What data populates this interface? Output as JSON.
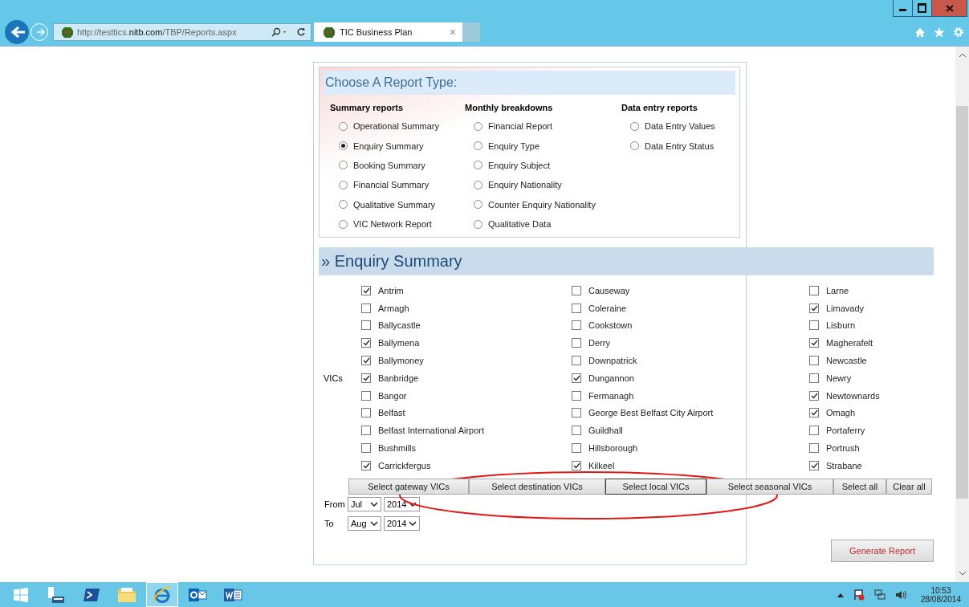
{
  "browser": {
    "address": "http://testtics.**nitb.com**/TBP/Reports.aspx",
    "tab_title": "TIC Business Plan",
    "tab_close": "×"
  },
  "report_type": {
    "title": "Choose A Report Type:",
    "groups": [
      {
        "heading": "Summary reports",
        "options": [
          {
            "label": "Operational Summary",
            "selected": false
          },
          {
            "label": "Enquiry Summary",
            "selected": true
          },
          {
            "label": "Booking Summary",
            "selected": false
          },
          {
            "label": "Financial Summary",
            "selected": false
          },
          {
            "label": "Qualitative Summary",
            "selected": false
          },
          {
            "label": "VIC Network Report",
            "selected": false
          }
        ]
      },
      {
        "heading": "Monthly breakdowns",
        "options": [
          {
            "label": "Financial Report",
            "selected": false
          },
          {
            "label": "Enquiry Type",
            "selected": false
          },
          {
            "label": "Enquiry Subject",
            "selected": false
          },
          {
            "label": "Enquiry Nationality",
            "selected": false
          },
          {
            "label": "Counter Enquiry Nationality",
            "selected": false
          },
          {
            "label": "Qualitative Data",
            "selected": false
          }
        ]
      },
      {
        "heading": "Data entry reports",
        "options": [
          {
            "label": "Data Entry Values",
            "selected": false
          },
          {
            "label": "Data Entry Status",
            "selected": false
          }
        ]
      }
    ]
  },
  "enquiry_summary": {
    "title": "» Enquiry Summary",
    "vics_label": "VICs",
    "columns": [
      {
        "items": [
          {
            "label": "Antrim",
            "checked": true
          },
          {
            "label": "Armagh",
            "checked": false
          },
          {
            "label": "Ballycastle",
            "checked": false
          },
          {
            "label": "Ballymena",
            "checked": true
          },
          {
            "label": "Ballymoney",
            "checked": true
          },
          {
            "label": "Banbridge",
            "checked": true
          },
          {
            "label": "Bangor",
            "checked": false
          },
          {
            "label": "Belfast",
            "checked": false
          },
          {
            "label": "Belfast International Airport",
            "checked": false
          },
          {
            "label": "Bushmills",
            "checked": false
          },
          {
            "label": "Carrickfergus",
            "checked": true
          }
        ]
      },
      {
        "items": [
          {
            "label": "Causeway",
            "checked": false
          },
          {
            "label": "Coleraine",
            "checked": false
          },
          {
            "label": "Cookstown",
            "checked": false
          },
          {
            "label": "Derry",
            "checked": false
          },
          {
            "label": "Downpatrick",
            "checked": false
          },
          {
            "label": "Dungannon",
            "checked": true
          },
          {
            "label": "Fermanagh",
            "checked": false
          },
          {
            "label": "George Best Belfast City Airport",
            "checked": false
          },
          {
            "label": "Guildhall",
            "checked": false
          },
          {
            "label": "Hillsborough",
            "checked": false
          },
          {
            "label": "Kilkeel",
            "checked": true
          }
        ]
      },
      {
        "items": [
          {
            "label": "Larne",
            "checked": false
          },
          {
            "label": "Limavady",
            "checked": true
          },
          {
            "label": "Lisburn",
            "checked": false
          },
          {
            "label": "Magherafelt",
            "checked": true
          },
          {
            "label": "Newcastle",
            "checked": false
          },
          {
            "label": "Newry",
            "checked": false
          },
          {
            "label": "Newtownards",
            "checked": true
          },
          {
            "label": "Omagh",
            "checked": true
          },
          {
            "label": "Portaferry",
            "checked": false
          },
          {
            "label": "Portrush",
            "checked": false
          },
          {
            "label": "Strabane",
            "checked": true
          }
        ]
      }
    ],
    "buttons": [
      {
        "label": "Select gateway VICs",
        "focused": false
      },
      {
        "label": "Select destination VICs",
        "focused": false
      },
      {
        "label": "Select local VICs",
        "focused": true
      },
      {
        "label": "Select seasonal VICs",
        "focused": false
      },
      {
        "label": "Select all",
        "focused": false
      },
      {
        "label": "Clear all",
        "focused": false
      }
    ],
    "date_rows": [
      {
        "label": "From",
        "month": "Jul",
        "year": "2014"
      },
      {
        "label": "To",
        "month": "Aug",
        "year": "2014"
      }
    ],
    "generate_button": "Generate Report"
  },
  "taskbar": {
    "time": "10:53",
    "date": "28/08/2014"
  }
}
